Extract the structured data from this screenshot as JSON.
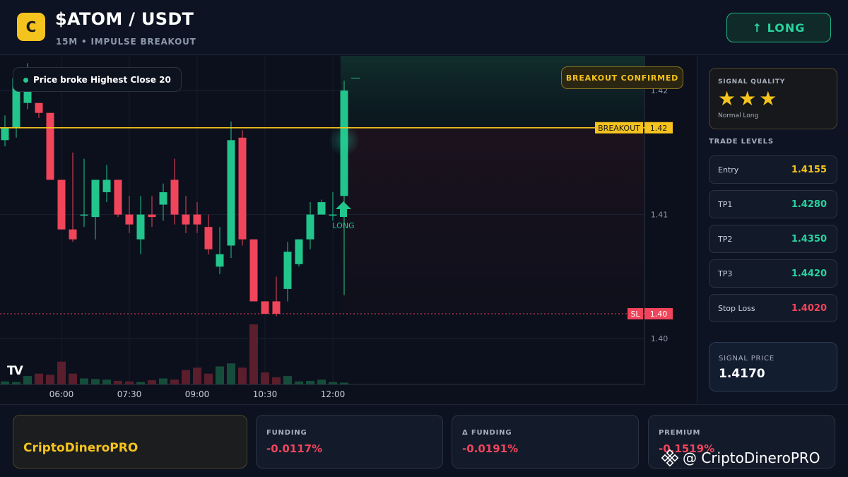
{
  "header": {
    "logo_letter": "C",
    "pair": "$ATOM / USDT",
    "subtitle": "15M • IMPULSE BREAKOUT",
    "direction_button": "↑ LONG"
  },
  "chart_overlay": {
    "info_pill": "Price broke Highest Close 20",
    "confirm_pill": "BREAKOUT CONFIRMED",
    "signal_marker": "LONG",
    "tv_logo": "TV",
    "breakout_label": "BREAKOUT",
    "breakout_value": "1.42",
    "sl_label": "SL",
    "sl_value": "1.40",
    "current_value": "1.42"
  },
  "chart_data": {
    "type": "candlestick",
    "y_ticks": [
      1.4,
      1.41,
      1.42
    ],
    "y_tick_labels": [
      "1.40",
      "1.41",
      "1.42"
    ],
    "ylim": [
      1.3963,
      1.4228
    ],
    "x_ticks": [
      "06:00",
      "07:30",
      "09:00",
      "10:30",
      "12:00"
    ],
    "breakout_level": 1.417,
    "stop_loss": 1.402,
    "current_price": 1.421,
    "candles": [
      {
        "o": 1.416,
        "h": 1.418,
        "c": 1.417,
        "l": 1.4155
      },
      {
        "o": 1.417,
        "h": 1.4218,
        "c": 1.421,
        "l": 1.4162
      },
      {
        "o": 1.419,
        "h": 1.4222,
        "c": 1.4215,
        "l": 1.4185
      },
      {
        "o": 1.419,
        "h": 1.419,
        "c": 1.4182,
        "l": 1.4178
      },
      {
        "o": 1.4182,
        "h": 1.4182,
        "c": 1.4128,
        "l": 1.4128
      },
      {
        "o": 1.4128,
        "h": 1.4128,
        "c": 1.4088,
        "l": 1.4088
      },
      {
        "o": 1.4088,
        "h": 1.415,
        "c": 1.408,
        "l": 1.4078
      },
      {
        "o": 1.41,
        "h": 1.4145,
        "c": 1.41,
        "l": 1.409
      },
      {
        "o": 1.4098,
        "h": 1.4128,
        "c": 1.4128,
        "l": 1.408
      },
      {
        "o": 1.4118,
        "h": 1.414,
        "c": 1.4128,
        "l": 1.411
      },
      {
        "o": 1.4128,
        "h": 1.4128,
        "c": 1.41,
        "l": 1.4098
      },
      {
        "o": 1.41,
        "h": 1.4115,
        "c": 1.4092,
        "l": 1.4085
      },
      {
        "o": 1.408,
        "h": 1.4115,
        "c": 1.41,
        "l": 1.4068
      },
      {
        "o": 1.41,
        "h": 1.4115,
        "c": 1.4098,
        "l": 1.409
      },
      {
        "o": 1.4108,
        "h": 1.4125,
        "c": 1.4118,
        "l": 1.4095
      },
      {
        "o": 1.4128,
        "h": 1.4145,
        "c": 1.41,
        "l": 1.4092
      },
      {
        "o": 1.41,
        "h": 1.4115,
        "c": 1.4092,
        "l": 1.4085
      },
      {
        "o": 1.41,
        "h": 1.411,
        "c": 1.4092,
        "l": 1.4085
      },
      {
        "o": 1.409,
        "h": 1.41,
        "c": 1.4072,
        "l": 1.4068
      },
      {
        "o": 1.4058,
        "h": 1.409,
        "c": 1.4068,
        "l": 1.4052
      },
      {
        "o": 1.4075,
        "h": 1.4175,
        "c": 1.416,
        "l": 1.4065
      },
      {
        "o": 1.4162,
        "h": 1.4168,
        "c": 1.408,
        "l": 1.4075
      },
      {
        "o": 1.408,
        "h": 1.408,
        "c": 1.403,
        "l": 1.403
      },
      {
        "o": 1.403,
        "h": 1.403,
        "c": 1.402,
        "l": 1.402
      },
      {
        "o": 1.403,
        "h": 1.405,
        "c": 1.402,
        "l": 1.4018
      },
      {
        "o": 1.404,
        "h": 1.4078,
        "c": 1.407,
        "l": 1.403
      },
      {
        "o": 1.406,
        "h": 1.408,
        "c": 1.408,
        "l": 1.4058
      },
      {
        "o": 1.408,
        "h": 1.411,
        "c": 1.41,
        "l": 1.4072
      },
      {
        "o": 1.41,
        "h": 1.4112,
        "c": 1.411,
        "l": 1.41
      },
      {
        "o": 1.41,
        "h": 1.4118,
        "c": 1.41,
        "l": 1.4095
      },
      {
        "o": 1.4115,
        "h": 1.4208,
        "c": 1.42,
        "l": 1.4035
      }
    ],
    "volume": [
      5,
      4,
      14,
      18,
      16,
      38,
      18,
      10,
      9,
      8,
      6,
      5,
      4,
      7,
      10,
      8,
      24,
      28,
      18,
      30,
      35,
      28,
      100,
      20,
      12,
      14,
      5,
      6,
      8,
      4,
      3
    ]
  },
  "panel": {
    "quality_label": "SIGNAL QUALITY",
    "stars": "★★★",
    "quality_sub": "Normal Long",
    "levels_title": "TRADE LEVELS",
    "levels": [
      {
        "label": "Entry",
        "value": "1.4155",
        "color": "#f5c31d"
      },
      {
        "label": "TP1",
        "value": "1.4280",
        "color": "#2ad39e"
      },
      {
        "label": "TP2",
        "value": "1.4350",
        "color": "#2ad39e"
      },
      {
        "label": "TP3",
        "value": "1.4420",
        "color": "#2ad39e"
      },
      {
        "label": "Stop Loss",
        "value": "1.4020",
        "color": "#f0455b"
      }
    ],
    "signal_price_label": "SIGNAL PRICE",
    "signal_price": "1.4170"
  },
  "footer": {
    "brand": "CriptoDineroPRO",
    "stats": [
      {
        "label": "FUNDING",
        "value": "-0.0117%"
      },
      {
        "label": "Δ FUNDING",
        "value": "-0.0191%"
      },
      {
        "label": "PREMIUM",
        "value": "-0.1519%"
      }
    ],
    "watermark": "@ CriptoDineroPRO"
  }
}
